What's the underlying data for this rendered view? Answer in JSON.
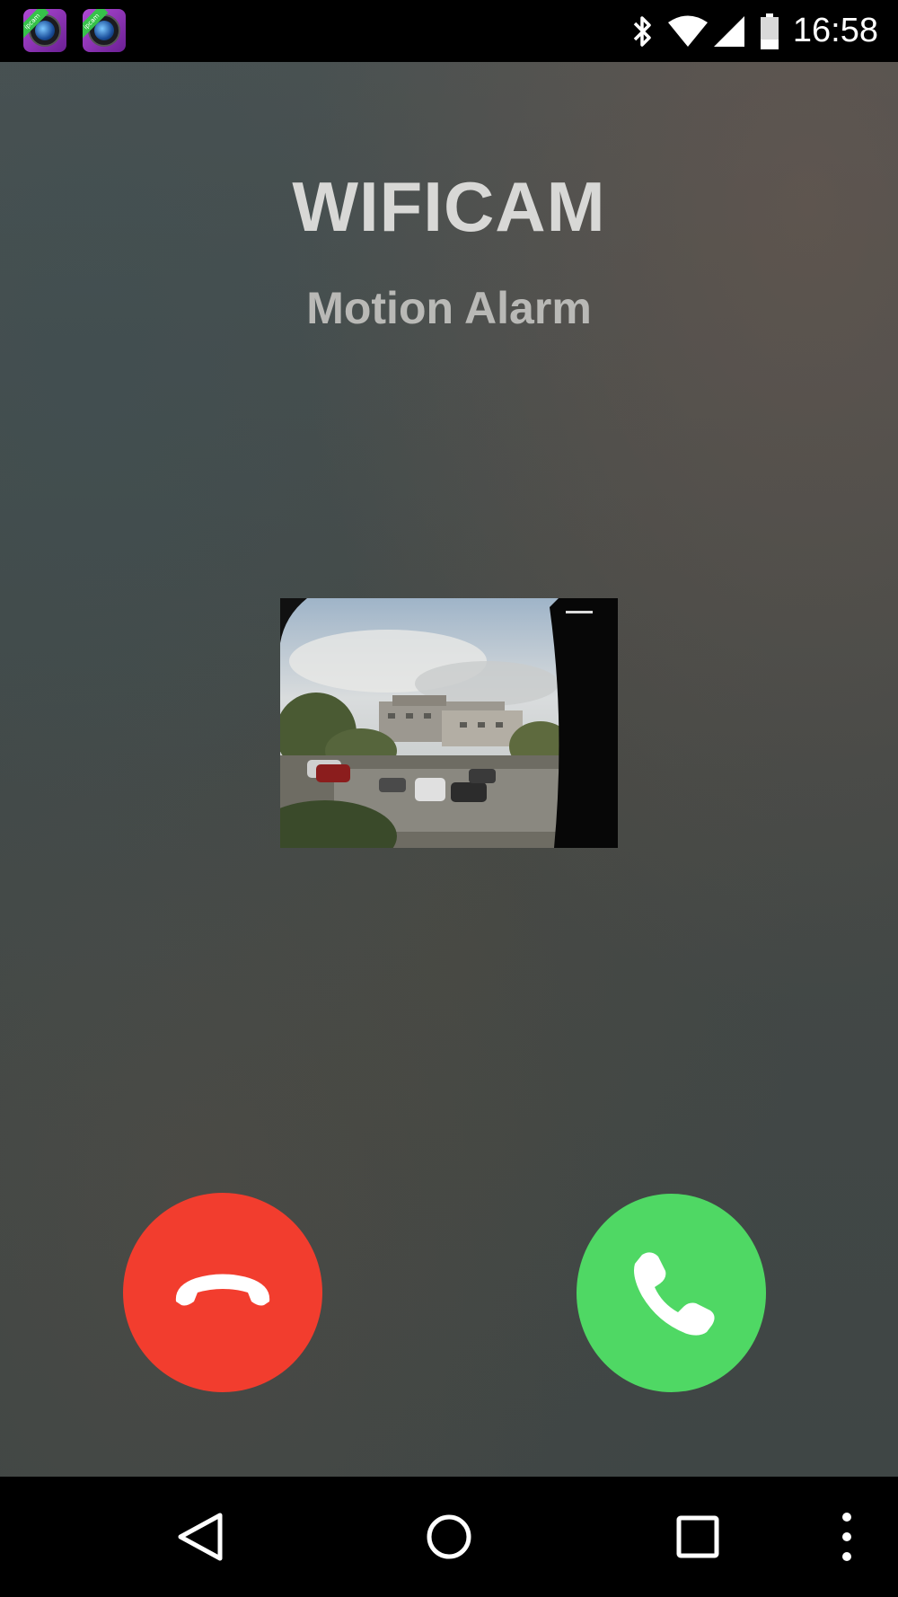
{
  "status_bar": {
    "time": "16:58",
    "notification_icons": [
      "ipcam-app-icon",
      "ipcam-app-icon"
    ],
    "notification_icon_badge_text": "ipcam",
    "system_icons": [
      "bluetooth-icon",
      "wifi-icon",
      "cell-signal-icon",
      "battery-icon"
    ]
  },
  "call": {
    "caller_name": "WIFICAM",
    "subtitle": "Motion Alarm",
    "snapshot_icon": "camera-snapshot-image",
    "decline_icon": "phone-hangup-icon",
    "accept_icon": "phone-answer-icon",
    "colors": {
      "decline": "#f23d2e",
      "accept": "#4fd864"
    }
  },
  "nav_bar": {
    "buttons": [
      "back-icon",
      "home-icon",
      "recents-icon",
      "more-options-icon"
    ]
  }
}
